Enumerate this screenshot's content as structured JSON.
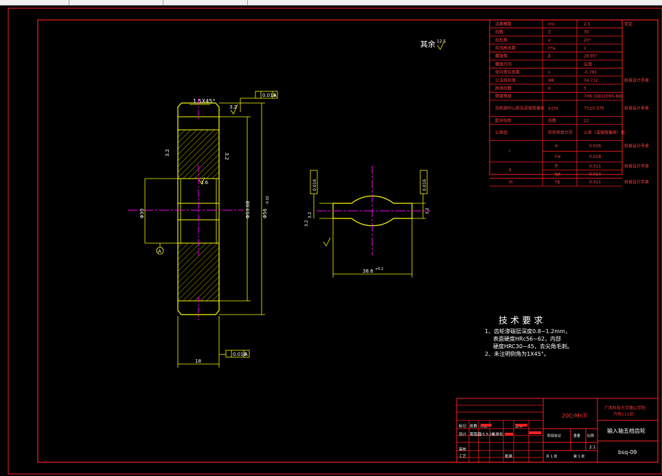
{
  "drawing": {
    "surface_finish_note": "其余",
    "surface_finish_value": "12.5",
    "chamfer_top": "1.5X45°",
    "roughness_a": "3.2",
    "roughness_b": "3.2",
    "roughness_c": "1.6",
    "roughness_d": "3.2",
    "geotol_top_value": "0.018",
    "geotol_top_datum": "A",
    "geotol_bottom_value": "0.018",
    "geotol_bottom_datum": "A",
    "datum_label": "A",
    "dim_width": "18",
    "dim_bore": "Φ30",
    "dim_root": "Φ53.68",
    "dim_tip": "Φ56",
    "dim_tip_tol": "-0.02",
    "dim_key_width": "38.6",
    "dim_key_tol": "+0.2",
    "dim_tol_frame_1": "0.016",
    "dim_tol_frame_2": "0.016",
    "dim_side_left": "3.2",
    "dim_side_right": "3.2",
    "dim_side_small": "3.2"
  },
  "params_table": {
    "rows": [
      {
        "label": "法面模数",
        "sym": "mn",
        "val": "2.5",
        "ref": "常定"
      },
      {
        "label": "齿数",
        "sym": "Z",
        "val": "30",
        "ref": ""
      },
      {
        "label": "齿形角",
        "sym": "α",
        "val": "20°",
        "ref": ""
      },
      {
        "label": "齿顶高系数",
        "sym": "h*a",
        "val": "1",
        "ref": ""
      },
      {
        "label": "螺旋角",
        "sym": "β",
        "val": "28.85°",
        "ref": ""
      },
      {
        "label": "螺旋方向",
        "sym": "",
        "val": "左旋",
        "ref": ""
      },
      {
        "label": "径向变位系数",
        "sym": "x",
        "val": "-0.781",
        "ref": ""
      },
      {
        "label": "公法线长度",
        "sym": "Wk",
        "val": "34.712",
        "ref": "机械设计手册"
      },
      {
        "label": "跨测齿数",
        "sym": "K",
        "val": "5",
        "ref": ""
      },
      {
        "label": "精度等级",
        "sym": "",
        "val": "7HK (GB10095-88)",
        "ref": ""
      },
      {
        "label": "齿轮副中心距及其极限偏差",
        "sym": "a±fa",
        "val": "75±0.035",
        "ref": "机械设计手册"
      },
      {
        "label": "配对齿轮",
        "sym": "齿数",
        "val": "22",
        "ref": ""
      },
      {
        "label": "公差组",
        "sym": "检验项目代号",
        "val": "公差（或极限偏差）值",
        "ref": ""
      }
    ],
    "groups": [
      {
        "name": "I",
        "items": [
          {
            "code": "Fr",
            "val": "0.036",
            "ref": "机械设计手册"
          },
          {
            "code": "Fw",
            "val": "0.028",
            "ref": ""
          }
        ]
      },
      {
        "name": "II",
        "items": [
          {
            "code": "ff",
            "val": "0.011",
            "ref": "机械设计手册"
          },
          {
            "code": "fpt",
            "val": "0.014",
            "ref": ""
          }
        ]
      },
      {
        "name": "III",
        "items": [
          {
            "code": "Fβ",
            "val": "0.011",
            "ref": "机械设计手册"
          }
        ]
      }
    ]
  },
  "tech_req": {
    "title": "技 术 要 求",
    "lines": [
      "1、齿轮渗碳层深度0.8~1.2mm，",
      "表面硬度HRc56~62，内部",
      "硬度HRC30~45，去尖角毛刺。",
      "2、未注明倒角为1X45°。"
    ]
  },
  "title_block": {
    "material": "20CrMnTi",
    "school": "广西科技大学鹿山学院",
    "class": "汽电111班",
    "part_name": "输入轴五档齿轮",
    "drawing_no": "bsq-09",
    "scale": "2:1",
    "label_mark": "标记",
    "label_count": "处数",
    "label_zone": "分区",
    "label_sign": "签名",
    "label_design": "设计",
    "label_design_name": "黄国昌",
    "label_date": "15.5.12",
    "label_std": "标准化",
    "label_stage": "阶段标记",
    "label_weight": "重量",
    "label_ratio": "比例",
    "label_review": "审核",
    "label_craft": "工艺",
    "label_approve": "批准",
    "label_sheet_total": "共  1  张",
    "label_sheet_no": "第  1  张"
  },
  "colors": {
    "line": "#ffff00",
    "frame": "#ff2020",
    "center": "#ff00ff",
    "text": "#ffffff",
    "bg": "#000000"
  }
}
